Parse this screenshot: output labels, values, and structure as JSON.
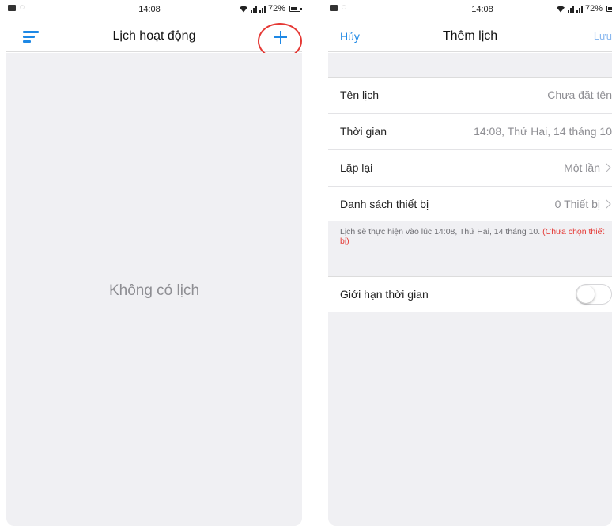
{
  "left_screen": {
    "status_bar": {
      "time": "14:08",
      "battery": "72%",
      "battery_level": 0.72
    },
    "header": {
      "title": "Lịch hoạt động",
      "menu_icon": "menu-icon",
      "add_icon": "plus-icon"
    },
    "empty_state": "Không có lịch"
  },
  "right_screen": {
    "status_bar": {
      "time": "14:08",
      "battery": "72%",
      "battery_level": 0.72
    },
    "header": {
      "cancel_label": "Hủy",
      "title": "Thêm lịch",
      "save_label": "Lưu"
    },
    "rows": [
      {
        "label": "Tên lịch",
        "value": "Chưa đặt tên"
      },
      {
        "label": "Thời gian",
        "value": "14:08, Thứ Hai, 14 tháng 10"
      },
      {
        "label": "Lặp lại",
        "value": "Một lần"
      },
      {
        "label": "Danh sách thiết bị",
        "value": "0 Thiết bị"
      }
    ],
    "note": {
      "text": "Lịch sẽ thực hiện vào lúc 14:08, Thứ Hai, 14 tháng 10. ",
      "warning": "(Chưa chọn thiết bị)"
    },
    "time_limit": {
      "label": "Giới hạn thời gian",
      "enabled": false
    }
  },
  "colors": {
    "accent": "#1e88e5",
    "highlight_circle": "#e53935",
    "background": "#f0f0f3"
  }
}
